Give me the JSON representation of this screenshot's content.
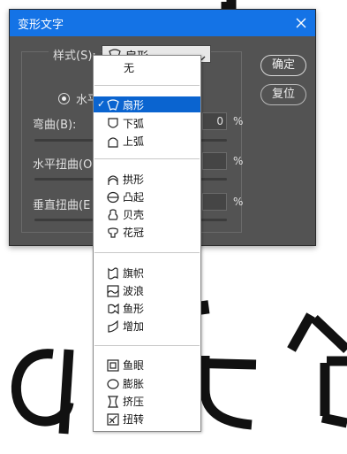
{
  "dialog": {
    "title": "变形文字",
    "style_label": "样式(S):",
    "selected_style": "扇形",
    "orientation_label": "水平",
    "bend_label": "弯曲(B):",
    "horizontal_distortion_label": "水平扭曲(O",
    "vertical_distortion_label": "垂直扭曲(E",
    "percent_symbol": "%",
    "bend_value_partial": "0",
    "ok_label": "确定",
    "reset_label": "复位"
  },
  "menu": {
    "check_glyph": "✓",
    "items": [
      {
        "label": "无",
        "icon": "none"
      },
      {
        "label": "扇形",
        "icon": "arc-icon"
      },
      {
        "label": "下弧",
        "icon": "arc-lower-icon"
      },
      {
        "label": "上弧",
        "icon": "arc-upper-icon"
      },
      {
        "label": "拱形",
        "icon": "arch-icon"
      },
      {
        "label": "凸起",
        "icon": "bulge-icon"
      },
      {
        "label": "贝壳",
        "icon": "shell-icon"
      },
      {
        "label": "花冠",
        "icon": "flower-icon"
      },
      {
        "label": "旗帜",
        "icon": "flag-icon"
      },
      {
        "label": "波浪",
        "icon": "wave-icon"
      },
      {
        "label": "鱼形",
        "icon": "fish-icon"
      },
      {
        "label": "增加",
        "icon": "rise-icon"
      },
      {
        "label": "鱼眼",
        "icon": "fisheye-icon"
      },
      {
        "label": "膨胀",
        "icon": "inflate-icon"
      },
      {
        "label": "挤压",
        "icon": "squeeze-icon"
      },
      {
        "label": "扭转",
        "icon": "twist-icon"
      }
    ]
  },
  "colors": {
    "titlebar": "#1473e6",
    "dialog_bg": "#535353",
    "menu_selected": "#0a64d0"
  }
}
